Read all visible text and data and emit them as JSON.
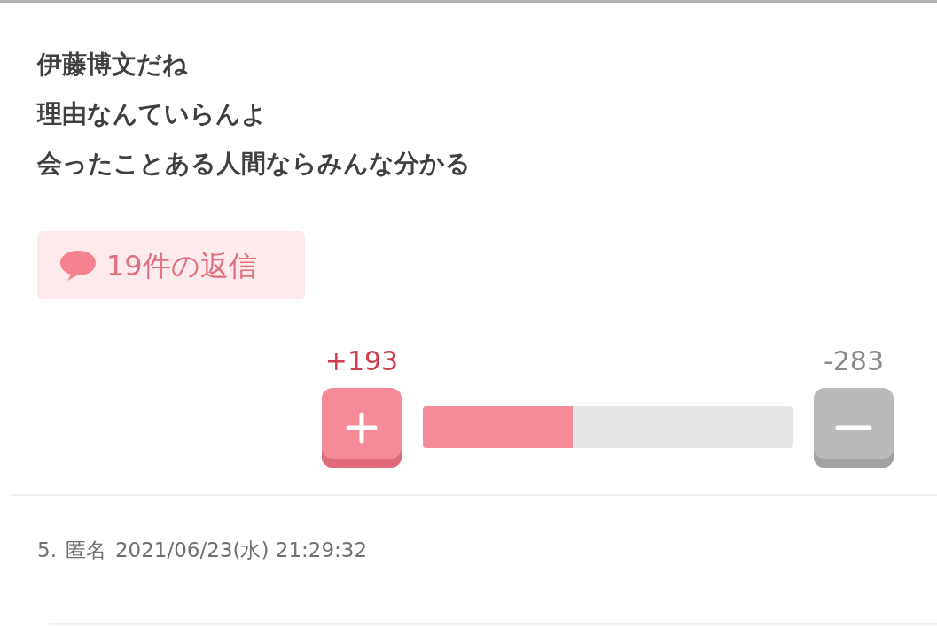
{
  "comment": {
    "lines": [
      "伊藤博文だね",
      "理由なんていらんよ",
      "会ったことある人間ならみんな分かる"
    ],
    "replies": "19件の返信",
    "votes": {
      "plus": "+193",
      "minus": "-283",
      "level": 0.405
    }
  },
  "next_comment": {
    "number": "5.",
    "author": "匿名",
    "date": "2021/06/23(水) 21:29:32"
  }
}
